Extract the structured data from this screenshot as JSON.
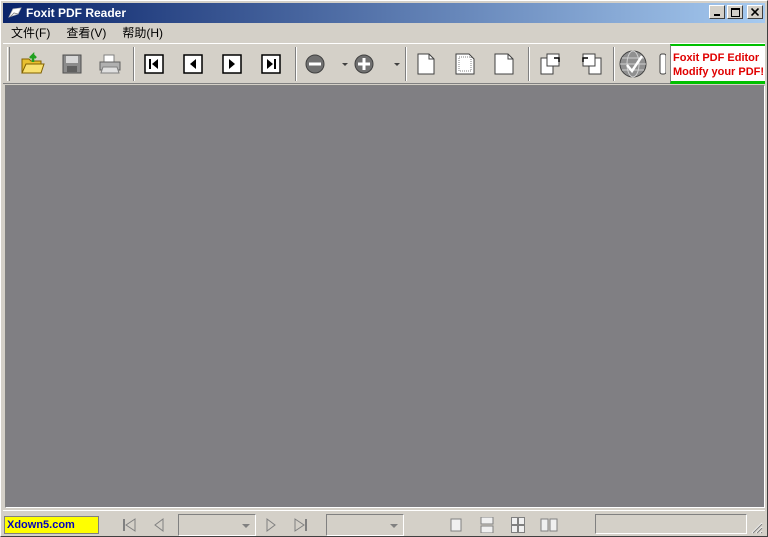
{
  "window": {
    "title": "Foxit PDF Reader"
  },
  "title_buttons": {
    "minimize": "_",
    "maximize": "□",
    "close": "×"
  },
  "menu": {
    "items": [
      {
        "label": "文件(F)"
      },
      {
        "label": "查看(V)"
      },
      {
        "label": "帮助(H)"
      }
    ]
  },
  "toolbar": {
    "icons": [
      "open-icon",
      "save-icon",
      "print-icon",
      "first-page-icon",
      "previous-page-icon",
      "next-page-icon",
      "last-page-icon",
      "zoom-out-icon",
      "zoom-in-icon",
      "actual-size-icon",
      "fit-page-icon",
      "fit-width-icon",
      "rotate-right-icon",
      "rotate-left-icon",
      "globe-icon"
    ]
  },
  "ad": {
    "line1": "Foxit PDF Editor",
    "line2": "Modify your PDF!"
  },
  "status": {
    "watermark": "Xdown5.com",
    "page_value": "",
    "zoom_value": ""
  },
  "colors": {
    "document_bg": "#807f83",
    "chrome_bg": "#d4d0c8",
    "ad_text": "#e00000",
    "ad_border": "#00c000",
    "watermark_bg": "#ffff00"
  }
}
